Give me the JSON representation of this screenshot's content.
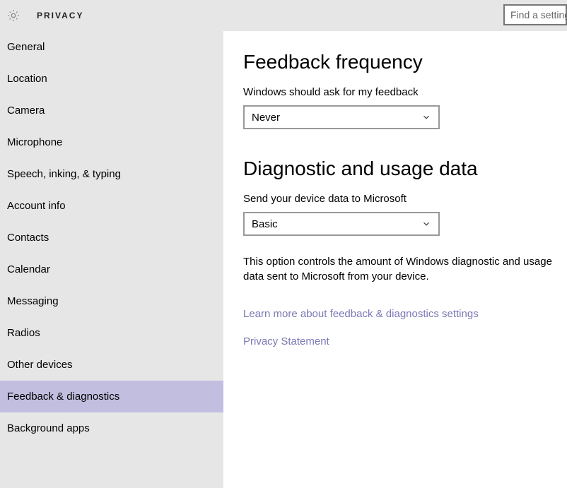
{
  "header": {
    "title": "PRIVACY",
    "search_placeholder": "Find a setting"
  },
  "sidebar": {
    "items": [
      {
        "label": "General",
        "selected": false
      },
      {
        "label": "Location",
        "selected": false
      },
      {
        "label": "Camera",
        "selected": false
      },
      {
        "label": "Microphone",
        "selected": false
      },
      {
        "label": "Speech, inking, & typing",
        "selected": false
      },
      {
        "label": "Account info",
        "selected": false
      },
      {
        "label": "Contacts",
        "selected": false
      },
      {
        "label": "Calendar",
        "selected": false
      },
      {
        "label": "Messaging",
        "selected": false
      },
      {
        "label": "Radios",
        "selected": false
      },
      {
        "label": "Other devices",
        "selected": false
      },
      {
        "label": "Feedback & diagnostics",
        "selected": true
      },
      {
        "label": "Background apps",
        "selected": false
      }
    ]
  },
  "main": {
    "feedback": {
      "heading": "Feedback frequency",
      "label": "Windows should ask for my feedback",
      "value": "Never"
    },
    "diagnostic": {
      "heading": "Diagnostic and usage data",
      "label": "Send your device data to Microsoft",
      "value": "Basic",
      "description": "This option controls the amount of Windows diagnostic and usage data sent to Microsoft from your device."
    },
    "links": {
      "learn_more": "Learn more about feedback & diagnostics settings",
      "privacy": "Privacy Statement"
    }
  }
}
